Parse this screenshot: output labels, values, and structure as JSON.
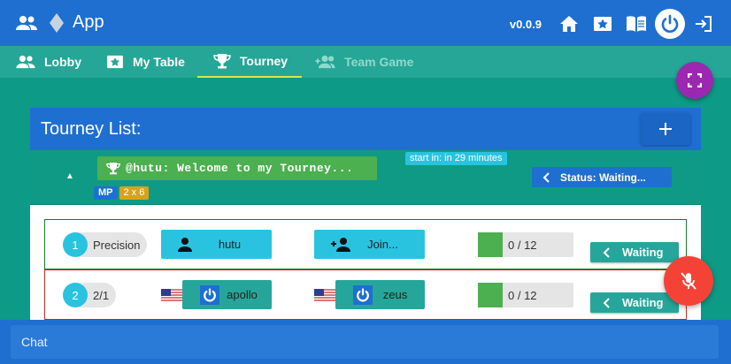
{
  "app": {
    "title": "App",
    "version": "v0.0.9"
  },
  "appbar_icons": [
    "people-icon",
    "diamond-icon",
    "home-icon",
    "star-ticket-icon",
    "book-icon",
    "power-icon",
    "logout-icon"
  ],
  "tabs": [
    {
      "label": "Lobby",
      "icon": "people-icon",
      "state": "normal"
    },
    {
      "label": "My Table",
      "icon": "star-ticket-icon",
      "state": "normal"
    },
    {
      "label": "Tourney",
      "icon": "trophy-icon",
      "state": "active"
    },
    {
      "label": "Team Game",
      "icon": "group-add-icon",
      "state": "disabled"
    }
  ],
  "panel": {
    "title": "Tourney List:",
    "add_label": "+"
  },
  "tourney": {
    "name": "@hutu: Welcome to my Tourney...",
    "starts_in": "start in: in 29 minutes",
    "status": "Status: Waiting...",
    "badges": [
      "MP",
      "2 x 6"
    ]
  },
  "tables": [
    {
      "index": "1",
      "label": "Precision",
      "players": [
        {
          "name": "hutu",
          "icon": "person-icon"
        },
        {
          "name": "Join...",
          "icon": "person-add-icon"
        }
      ],
      "progress": "0 / 12",
      "status": "Waiting"
    },
    {
      "index": "2",
      "label": "2/1",
      "players": [
        {
          "name": "apollo",
          "icon": "power-icon",
          "flag": "us-flag-icon"
        },
        {
          "name": "zeus",
          "icon": "power-icon",
          "flag": "us-flag-icon"
        }
      ],
      "progress": "0 / 12",
      "status": "Waiting"
    }
  ],
  "chat": {
    "placeholder": "Chat"
  },
  "colors": {
    "appbar": "#1f6fd1",
    "background": "#0d9a86",
    "tabs": "#26a696",
    "fullscreen_fab": "#9c27b0",
    "mic_fab": "#f44336",
    "cyan_button": "#29c3e0",
    "teal_button": "#26a69a",
    "green": "#4caf50"
  }
}
